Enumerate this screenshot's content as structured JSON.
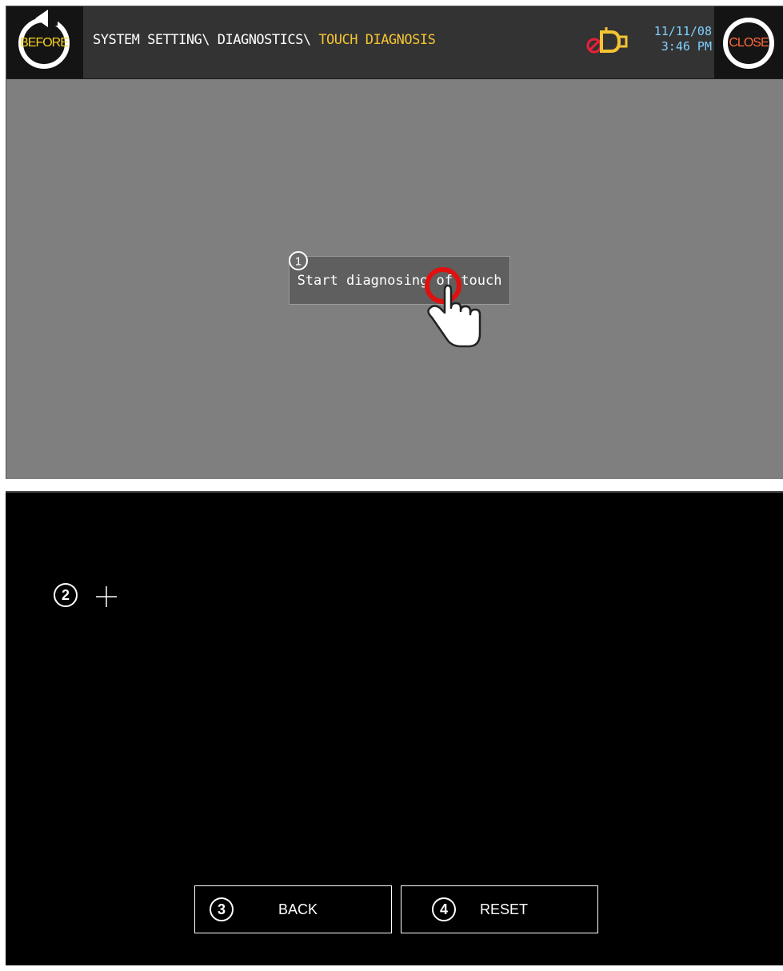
{
  "screen1": {
    "before_label": "BEFORE",
    "close_label": "CLOSE",
    "breadcrumb": {
      "path": "SYSTEM SETTING\\ DIAGNOSTICS\\ ",
      "current": "TOUCH DIAGNOSIS"
    },
    "date": "11/11/08",
    "time": "3:46 PM",
    "start_button_label": "Start diagnosing of touch",
    "step1": "1",
    "colors": {
      "topbar": "#333333",
      "accent_yellow": "#f5c433",
      "close_red": "#ff6a3a",
      "clock_blue": "#7fd1ff",
      "highlight_red": "#e01010"
    },
    "icons": [
      "refresh-arrow-icon",
      "alarm-bell-icon",
      "hand-pointer-icon"
    ]
  },
  "screen2": {
    "step2": "2",
    "step3": "3",
    "step4": "4",
    "back_label": "BACK",
    "reset_label": "RESET",
    "icons": [
      "crosshair-icon"
    ]
  }
}
